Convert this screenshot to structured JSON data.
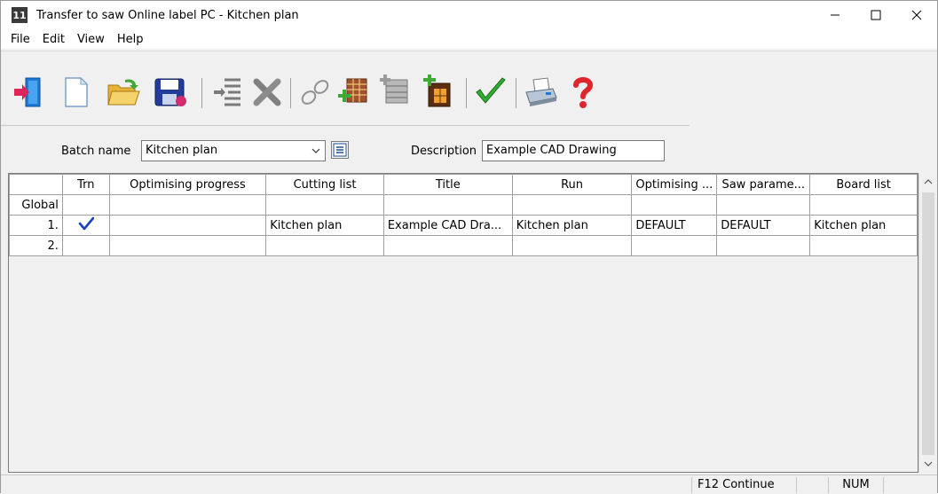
{
  "window": {
    "icon_text": "11",
    "title": "Transfer to saw Online label PC - Kitchen plan"
  },
  "menu": [
    "File",
    "Edit",
    "View",
    "Help"
  ],
  "toolbar": {
    "tools": [
      {
        "name": "exit-icon"
      },
      {
        "name": "new-file-icon"
      },
      {
        "name": "open-folder-icon"
      },
      {
        "name": "save-icon"
      },
      {
        "name": "insert-line-icon"
      },
      {
        "name": "delete-icon"
      },
      {
        "name": "link-icon"
      },
      {
        "name": "add-batch-icon"
      },
      {
        "name": "copy-list-icon"
      },
      {
        "name": "add-board-icon"
      },
      {
        "name": "checkmark-icon"
      },
      {
        "name": "print-icon"
      },
      {
        "name": "help-icon"
      }
    ]
  },
  "batch": {
    "batch_name_label": "Batch name",
    "batch_name_value": "Kitchen plan",
    "description_label": "Description",
    "description_value": "Example CAD Drawing"
  },
  "grid": {
    "columns": [
      "",
      "Trn",
      "Optimising progress",
      "Cutting list",
      "Title",
      "Run",
      "Optimising ...",
      "Saw parame...",
      "Board list"
    ],
    "rows": [
      {
        "head": "Global",
        "trn": "",
        "progress": "",
        "cutting_list": "",
        "title": "",
        "run": "",
        "optimising": "",
        "saw_params": "",
        "board_list": ""
      },
      {
        "head": "1.",
        "trn": "✔",
        "progress": "",
        "cutting_list": "Kitchen plan",
        "title": "Example CAD Dra...",
        "run": "Kitchen plan",
        "optimising": "DEFAULT",
        "saw_params": "DEFAULT",
        "board_list": "Kitchen plan"
      },
      {
        "head": "2.",
        "trn": "",
        "progress": "",
        "cutting_list": "",
        "title": "",
        "run": "",
        "optimising": "",
        "saw_params": "",
        "board_list": ""
      }
    ]
  },
  "status": {
    "continue": "F12 Continue",
    "num": "NUM"
  }
}
